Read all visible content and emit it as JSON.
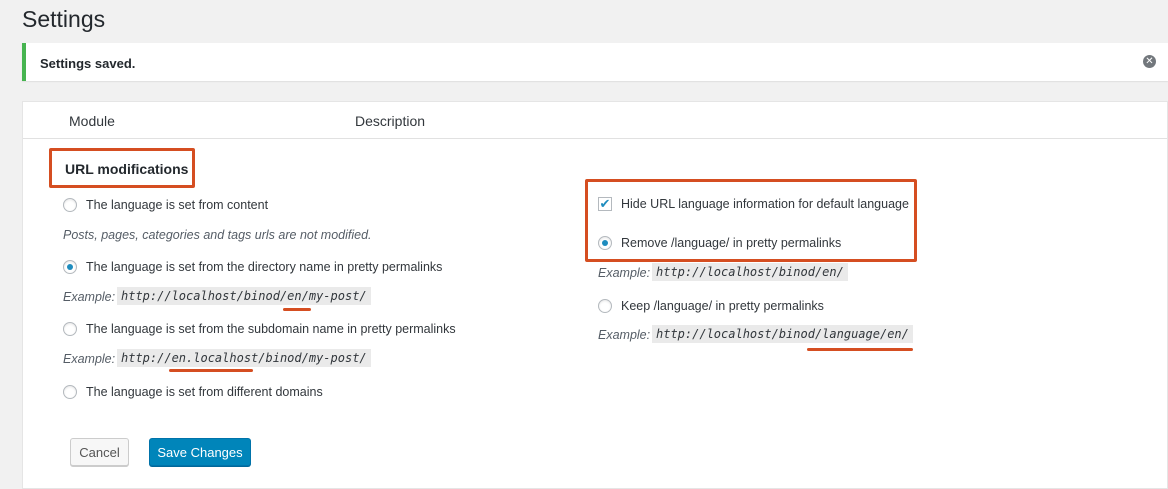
{
  "page": {
    "title": "Settings"
  },
  "notice": {
    "text": "Settings saved.",
    "dismiss_icon": "✕"
  },
  "table": {
    "col_module": "Module",
    "col_description": "Description"
  },
  "section": {
    "title": "URL modifications",
    "left_options": [
      {
        "label": "The language is set from content",
        "checked": false
      },
      {
        "label": "The language is set from the directory name in pretty permalinks",
        "checked": true
      },
      {
        "label": "The language is set from the subdomain name in pretty permalinks",
        "checked": false
      },
      {
        "label": "The language is set from different domains",
        "checked": false
      }
    ],
    "content_desc": "Posts, pages, categories and tags urls are not modified.",
    "example_label": "Example:",
    "example_directory": "http://localhost/binod/en/my-post/",
    "example_subdomain": "http://en.localhost/binod/my-post/",
    "right": {
      "hide_default": {
        "label": "Hide URL language information for default language",
        "checked": true
      },
      "remove_language": {
        "label": "Remove /language/ in pretty permalinks",
        "checked": true
      },
      "remove_example": "http://localhost/binod/en/",
      "keep_language": {
        "label": "Keep /language/ in pretty permalinks",
        "checked": false
      },
      "keep_example": "http://localhost/binod/language/en/"
    }
  },
  "buttons": {
    "cancel": "Cancel",
    "save": "Save Changes"
  },
  "colors": {
    "highlight": "#d54e21",
    "primary": "#0085ba",
    "success": "#46b450"
  }
}
